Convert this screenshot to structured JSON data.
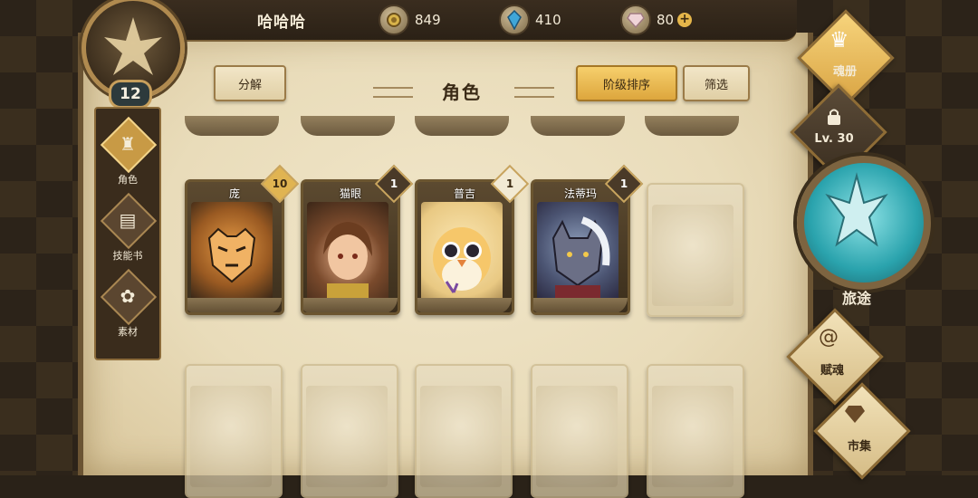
{
  "header": {
    "player_name": "哈哈哈",
    "resources": [
      {
        "icon": "gold-coin-icon",
        "value": "849"
      },
      {
        "icon": "blue-crystal-icon",
        "value": "410"
      },
      {
        "icon": "pink-gem-icon",
        "value": "80",
        "plus": "+"
      }
    ],
    "player_level": "12"
  },
  "left_nav": {
    "items": [
      {
        "label": "角色",
        "icon": "character-helmet-icon",
        "active": true
      },
      {
        "label": "技能书",
        "icon": "skill-book-icon",
        "active": false
      },
      {
        "label": "素材",
        "icon": "material-icon",
        "active": false
      }
    ]
  },
  "main": {
    "title": "角色",
    "decompose_label": "分解",
    "sort_label": "阶级排序",
    "filter_label": "筛选",
    "cards": [
      {
        "name": "庞",
        "badge": "10",
        "badge_style": "gold",
        "portrait": "tiger",
        "colors": [
          "#c77a2a",
          "#3a2a1a"
        ]
      },
      {
        "name": "猫眼",
        "badge": "1",
        "badge_style": "dark",
        "portrait": "girl-brown-hair",
        "colors": [
          "#7a4a2c",
          "#d9a27a"
        ]
      },
      {
        "name": "普吉",
        "badge": "1",
        "badge_style": "light",
        "portrait": "owl-chick",
        "colors": [
          "#f2c25a",
          "#e98a4a"
        ]
      },
      {
        "name": "法蒂玛",
        "badge": "1",
        "badge_style": "dark",
        "portrait": "cat-warrior",
        "colors": [
          "#5d6f8c",
          "#3b3550"
        ]
      }
    ],
    "locked_cards_row1": 1,
    "locked_cards_row2": 5
  },
  "right_nav": {
    "soul_book_label": "魂册",
    "locked_level_label": "Lv. 30",
    "journey_label": "旅途",
    "talent_label": "赋魂",
    "market_label": "市集"
  },
  "colors": {
    "parchment": "#eadcbb",
    "gold_accent": "#e5b64a",
    "frame_brown": "#6b5530"
  }
}
